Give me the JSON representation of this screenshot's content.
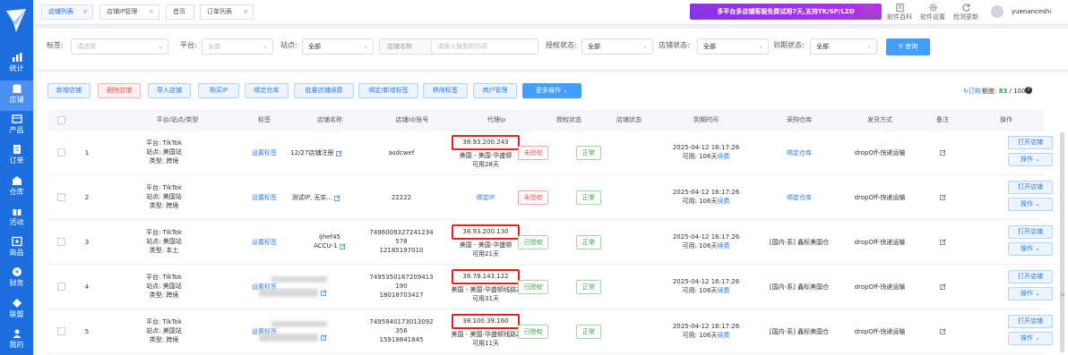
{
  "sidebar": {
    "items": [
      {
        "label": "统计",
        "icon": "bar-chart-icon"
      },
      {
        "label": "店铺",
        "icon": "shop-icon"
      },
      {
        "label": "产品",
        "icon": "product-icon"
      },
      {
        "label": "订单",
        "icon": "order-icon"
      },
      {
        "label": "仓库",
        "icon": "warehouse-icon"
      },
      {
        "label": "活动",
        "icon": "gift-icon"
      },
      {
        "label": "商品",
        "icon": "goods-icon"
      },
      {
        "label": "财务",
        "icon": "money-icon"
      },
      {
        "label": "联盟",
        "icon": "alliance-icon"
      },
      {
        "label": "我的",
        "icon": "user-icon"
      }
    ]
  },
  "tabs": [
    {
      "label": "店铺列表"
    },
    {
      "label": "店铺IP管理"
    },
    {
      "label": "首页"
    },
    {
      "label": "订单列表"
    }
  ],
  "promo": "多平台多店铺客服免费试用7天,支持TK/SP/LZD",
  "tools": [
    {
      "label": "客户经理"
    },
    {
      "label": "软件百科"
    },
    {
      "label": "软件设置"
    },
    {
      "label": "检测更新"
    }
  ],
  "user": {
    "name": "yuenanceshi"
  },
  "filters": {
    "tag_label": "标签:",
    "tag_placeholder": "请选择",
    "platform_label": "平台:",
    "platform_value": "全部",
    "site_label": "站点:",
    "site_value": "全部",
    "store_name_prefix": "店铺名称",
    "store_name_placeholder": "请输入搜索的内容",
    "auth_label": "授权状态:",
    "auth_value": "全部",
    "store_status_label": "店铺状态:",
    "store_status_value": "全部",
    "expire_label": "到期状态:",
    "expire_value": "全部",
    "query_label": "查询"
  },
  "actions": [
    {
      "label": "新增店铺"
    },
    {
      "label": "删除店铺"
    },
    {
      "label": "导入店铺"
    },
    {
      "label": "购买IP"
    },
    {
      "label": "绑定仓库"
    },
    {
      "label": "批量店铺续费"
    },
    {
      "label": "绑定/新增标签"
    },
    {
      "label": "移除标签"
    },
    {
      "label": "商户管理"
    },
    {
      "label": "更多操作"
    }
  ],
  "subscribe": "订购",
  "quota": {
    "label": "额度:",
    "used": "83",
    "total": "/ 100"
  },
  "table": {
    "headers": [
      "平台/站点/类型",
      "标签",
      "店铺名称",
      "店铺id/账号",
      "代理ip",
      "授权状态",
      "店铺状态",
      "到期时间",
      "采购仓库",
      "发货方式",
      "备注",
      "操作"
    ],
    "rows": [
      {
        "no": "1",
        "platform": "平台: TikTok",
        "site": "站点: 美国站",
        "type": "类型: 跨境",
        "tag": "设置标签",
        "store_name": "12/27店铺注册",
        "store_id": [
          "asdcwef"
        ],
        "ip": "38.93.200.243",
        "ip_line2": "美国 - 美国-华盛顿",
        "ip_line3": "可用28天",
        "auth": "未授权",
        "auth_ok": false,
        "status": "正常",
        "expire": "2025-04-12 16:17:26",
        "days_label": "可用: 106天",
        "renew": "续费",
        "warehouse": "绑定仓库",
        "ship": "dropOff-快递运输",
        "open": "打开店铺",
        "op": "操作"
      },
      {
        "no": "2",
        "platform": "平台: TikTok",
        "site": "站点: 美国站",
        "type": "类型: 跨境",
        "tag": "设置标签",
        "store_name": "测试IP, 无实...",
        "store_id": [
          "22222"
        ],
        "ip": "绑定IP",
        "ip_line2": "",
        "ip_line3": "",
        "auth": "未授权",
        "auth_ok": false,
        "status": "正常",
        "expire": "2025-04-12 16:17:26",
        "days_label": "可用: 106天",
        "renew": "续费",
        "warehouse": "绑定仓库",
        "ship": "dropOff-快递运输",
        "open": "打开店铺",
        "op": "操作"
      },
      {
        "no": "3",
        "platform": "平台: TikTok",
        "site": "站点: 美国站",
        "type": "类型: 本土",
        "tag": "设置标签",
        "store_name": "ijhef45",
        "store_name2": "ACCU-1",
        "store_id": [
          "7496009327241234",
          "578",
          "12185197010"
        ],
        "ip": "38.93.200.130",
        "ip_line2": "美国 - 美国-华盛顿",
        "ip_line3": "可用21天",
        "auth": "已授权",
        "auth_ok": true,
        "status": "正常",
        "expire": "2025-04-12 16:17:26",
        "days_label": "可用: 106天",
        "renew": "续费",
        "warehouse": "[国内-系] 鑫标美国仓",
        "ship": "dropOff-快递运输",
        "open": "打开店铺",
        "op": "操作"
      },
      {
        "no": "4",
        "platform": "平台: TikTok",
        "site": "站点: 美国站",
        "type": "类型: 跨境",
        "tag": "设置标签",
        "store_name": "",
        "store_id": [
          "7495350167209413",
          "190",
          "18018703417"
        ],
        "ip": "38.78.143.122",
        "ip_line2": "美国 - 美国-华盛顿线路2",
        "ip_line3": "可用31天",
        "auth": "已授权",
        "auth_ok": true,
        "status": "正常",
        "expire": "2025-04-12 16:17:26",
        "days_label": "可用: 106天",
        "renew": "续费",
        "warehouse": "[国内-系] 鑫标美国仓",
        "ship": "dropOff-快递运输",
        "open": "打开店铺",
        "op": "操作"
      },
      {
        "no": "5",
        "platform": "平台: TikTok",
        "site": "站点: 美国站",
        "type": "类型: 跨境",
        "tag": "设置标签",
        "store_name": "",
        "store_id": [
          "7495940173013092",
          "356",
          "15918841845"
        ],
        "ip": "38.100.39.160",
        "ip_line2": "美国 - 美国-华盛顿线路2",
        "ip_line3": "可用11天",
        "auth": "已授权",
        "auth_ok": true,
        "status": "正常",
        "expire": "2025-04-12 16:17:26",
        "days_label": "可用: 106天",
        "renew": "续费",
        "warehouse": "[国内-系] 鑫标美国仓",
        "ship": "dropOff-快递运输",
        "open": "打开店铺",
        "op": "操作"
      }
    ]
  }
}
